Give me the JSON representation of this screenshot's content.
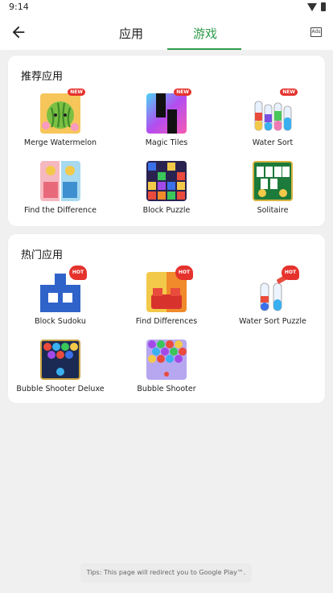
{
  "status": {
    "time": "9:14"
  },
  "nav": {
    "tabs": [
      "应用",
      "游戏"
    ],
    "active_tab": "游戏"
  },
  "recommended": {
    "title": "推荐应用",
    "apps": [
      {
        "name": "Merge Watermelon",
        "badge": "NEW",
        "icon": "watermelon-icon"
      },
      {
        "name": "Magic Tiles",
        "badge": "NEW",
        "icon": "piano-tiles-icon"
      },
      {
        "name": "Water Sort",
        "badge": "NEW",
        "icon": "test-tubes-icon"
      },
      {
        "name": "Find the Difference",
        "badge": "",
        "icon": "find-difference-icon"
      },
      {
        "name": "Block Puzzle",
        "badge": "",
        "icon": "block-puzzle-icon"
      },
      {
        "name": "Solitaire",
        "badge": "",
        "icon": "solitaire-cards-icon"
      }
    ]
  },
  "hot": {
    "title": "热门应用",
    "apps": [
      {
        "name": "Block Sudoku",
        "badge": "HOT",
        "icon": "block-sudoku-icon"
      },
      {
        "name": "Find Differences",
        "badge": "HOT",
        "icon": "find-differences-icon"
      },
      {
        "name": "Water Sort Puzzle",
        "badge": "HOT",
        "icon": "water-sort-bottles-icon"
      },
      {
        "name": "Bubble Shooter Deluxe",
        "badge": "",
        "icon": "bubble-shooter-deluxe-icon"
      },
      {
        "name": "Bubble Shooter",
        "badge": "",
        "icon": "bubble-shooter-icon"
      }
    ]
  },
  "toast": "Tips: This page will redirect you to Google Play™."
}
